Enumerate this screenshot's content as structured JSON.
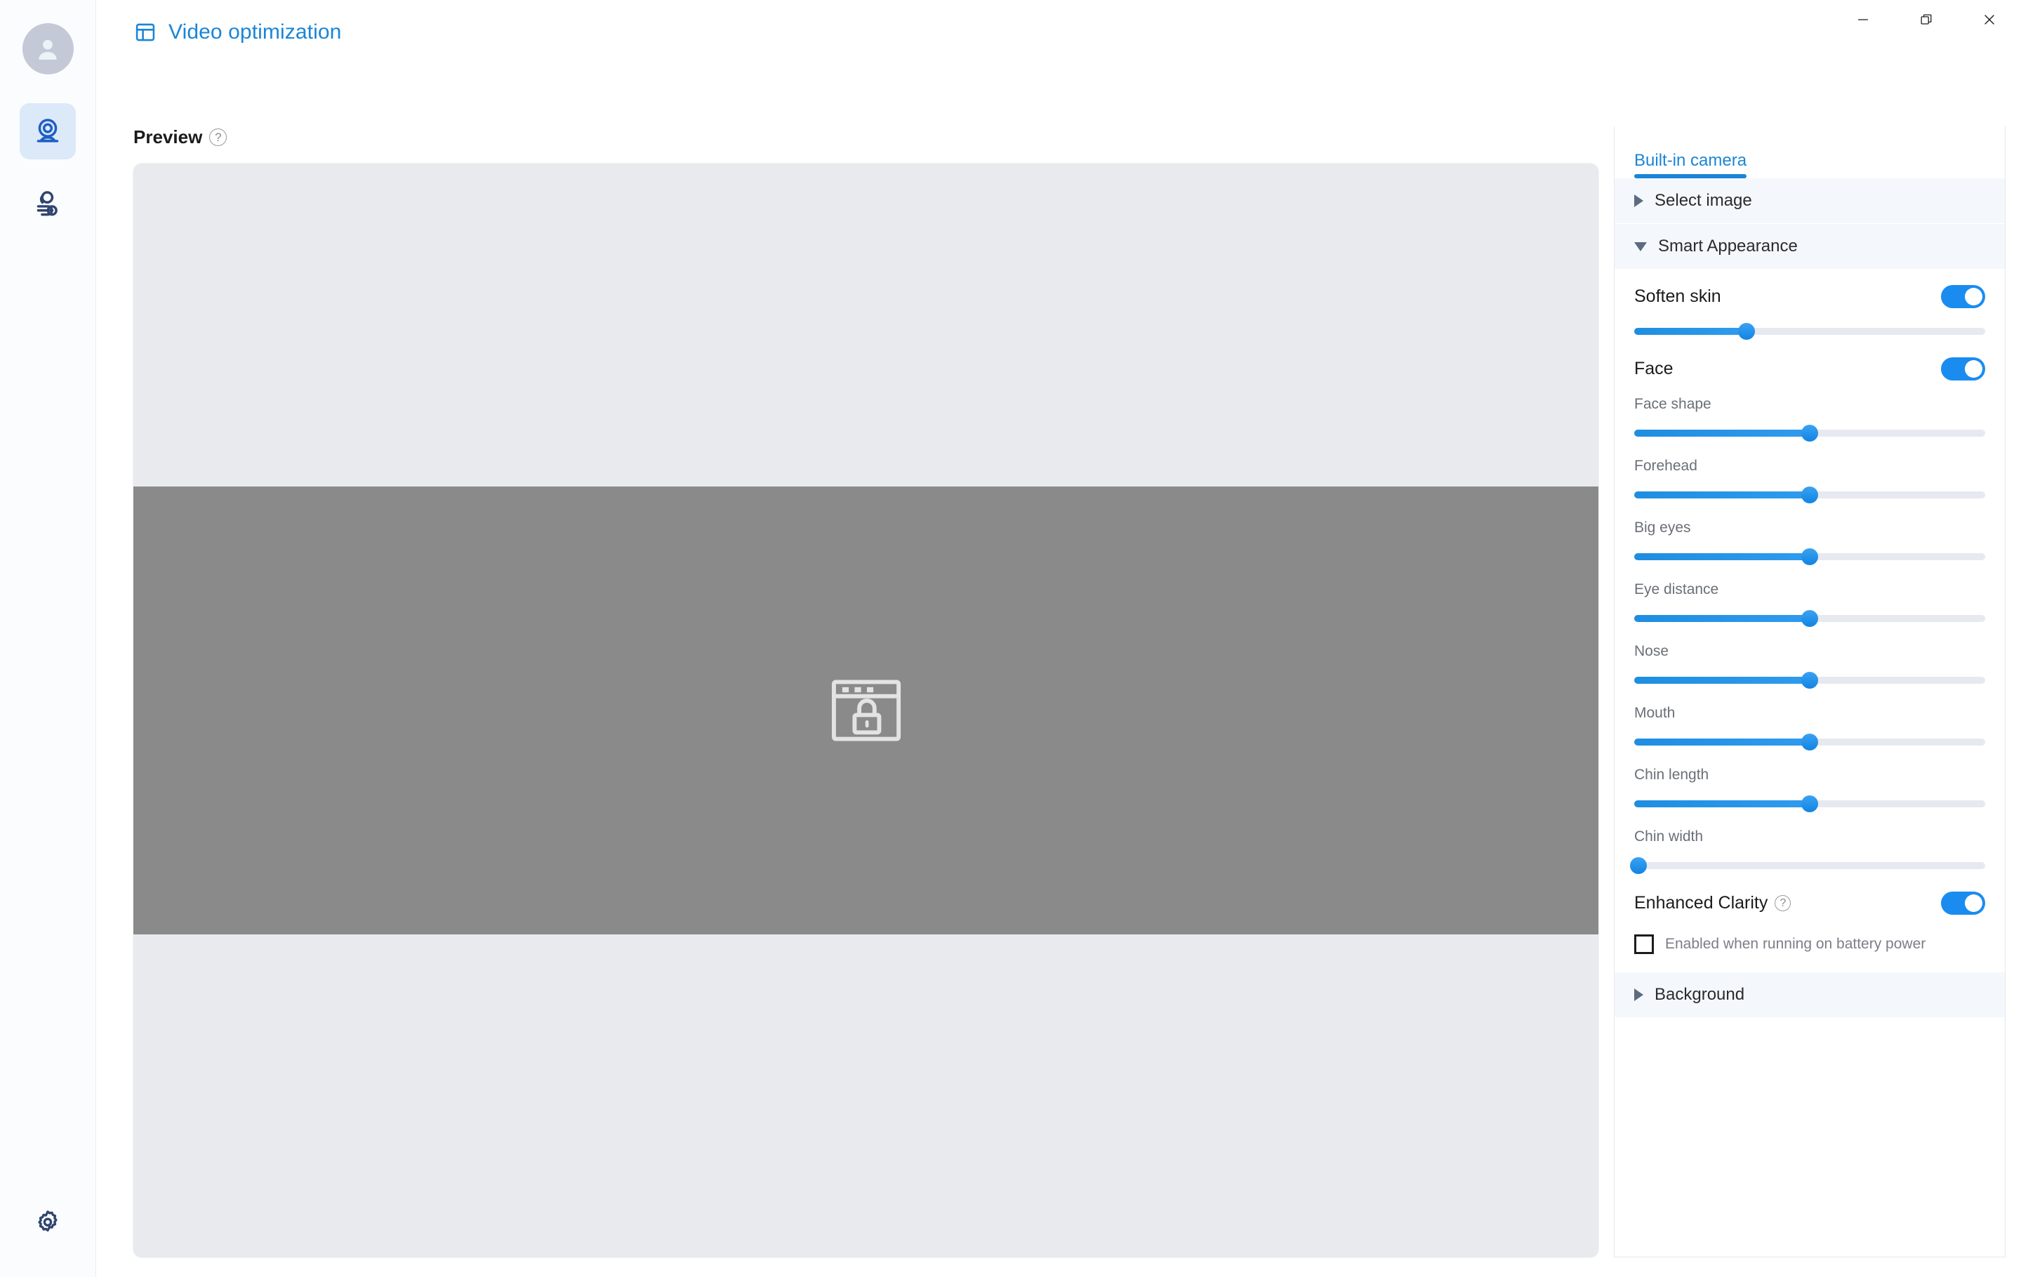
{
  "window": {
    "controls": [
      {
        "name": "minimize",
        "label": "Minimize"
      },
      {
        "name": "restore",
        "label": "Restore"
      },
      {
        "name": "close",
        "label": "Close"
      }
    ]
  },
  "colors": {
    "accent": "#1a85d6",
    "toggle_on": "#1a8cf0",
    "slider_fill": "#1f8ee0",
    "rail_active_bg": "#dbe9f9",
    "preview_bg": "#e8eaee",
    "video_bg": "#8a8a8a",
    "section_header_bg": "#f4f8fd"
  },
  "rail": {
    "avatar": "user-avatar",
    "items": [
      {
        "name": "webcam",
        "icon": "webcam-icon",
        "active": true
      },
      {
        "name": "person-effects",
        "icon": "person-effects-icon",
        "active": false
      }
    ],
    "bottom": {
      "name": "settings",
      "icon": "gear-icon"
    }
  },
  "header": {
    "icon": "layout-panel-icon",
    "title": "Video optimization"
  },
  "preview": {
    "label": "Preview",
    "help": "?",
    "placeholder_icon": "window-lock-icon"
  },
  "panel": {
    "tabs": [
      {
        "label": "Built-in camera",
        "active": true
      }
    ],
    "sections": [
      {
        "id": "select_image",
        "label": "Select image",
        "expanded": false
      },
      {
        "id": "smart_appearance",
        "label": "Smart Appearance",
        "expanded": true
      },
      {
        "id": "background",
        "label": "Background",
        "expanded": false
      }
    ],
    "smart_appearance": {
      "soften_skin": {
        "label": "Soften skin",
        "toggle_on": true,
        "slider_value": 32
      },
      "face": {
        "label": "Face",
        "toggle_on": true,
        "sliders": [
          {
            "label": "Face shape",
            "value": 50
          },
          {
            "label": "Forehead",
            "value": 50
          },
          {
            "label": "Big eyes",
            "value": 50
          },
          {
            "label": "Eye distance",
            "value": 50
          },
          {
            "label": "Nose",
            "value": 50
          },
          {
            "label": "Mouth",
            "value": 50
          },
          {
            "label": "Chin length",
            "value": 50
          },
          {
            "label": "Chin width",
            "value": 0
          }
        ]
      },
      "enhanced_clarity": {
        "label": "Enhanced Clarity",
        "help": "?",
        "toggle_on": true,
        "checkbox_label": "Enabled when running on battery power",
        "checkbox_checked": false
      }
    }
  }
}
